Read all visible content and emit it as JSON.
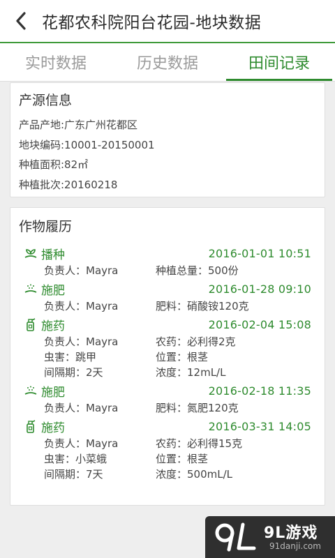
{
  "header": {
    "title": "花都农科院阳台花园-地块数据",
    "back_icon": "chevron-left-icon"
  },
  "tabs": [
    {
      "label": "实时数据",
      "active": false
    },
    {
      "label": "历史数据",
      "active": false
    },
    {
      "label": "田间记录",
      "active": true
    }
  ],
  "origin": {
    "title": "产源信息",
    "lines": [
      "产品产地:广东广州花都区",
      "地块编码:10001-20150001",
      "种植面积:82㎡",
      "种植批次:20160218"
    ]
  },
  "history": {
    "title": "作物履历",
    "records": [
      {
        "icon": "sowing-icon",
        "name": "播种",
        "time": "2016-01-01 10:51",
        "rows": [
          [
            "负责人：Mayra",
            "种植总量：500份"
          ]
        ]
      },
      {
        "icon": "fertilize-icon",
        "name": "施肥",
        "time": "2016-01-28 09:10",
        "rows": [
          [
            "负责人：Mayra",
            "肥料：硝酸铵120克"
          ]
        ]
      },
      {
        "icon": "spray-icon",
        "name": "施药",
        "time": "2016-02-04 15:08",
        "rows": [
          [
            "负责人：Mayra",
            "农药：必利得2克"
          ],
          [
            "虫害：跳甲",
            "位置：根茎"
          ],
          [
            "间隔期：2天",
            "浓度：12mL/L"
          ]
        ]
      },
      {
        "icon": "fertilize-icon",
        "name": "施肥",
        "time": "2016-02-18 11:35",
        "rows": [
          [
            "负责人：Mayra",
            "肥料：氮肥120克"
          ]
        ]
      },
      {
        "icon": "spray-icon",
        "name": "施药",
        "time": "2016-03-31 14:05",
        "rows": [
          [
            "负责人：Mayra",
            "农药：必利得15克"
          ],
          [
            "虫害：小菜蛾",
            "位置：根茎"
          ],
          [
            "间隔期：7天",
            "浓度：500mL/L"
          ]
        ]
      }
    ]
  },
  "watermark": {
    "main": "9L游戏",
    "sub": "91danji.com"
  },
  "colors": {
    "accent": "#2e8b2e",
    "header_line": "#3f9a3a",
    "background": "#eeeeee"
  }
}
